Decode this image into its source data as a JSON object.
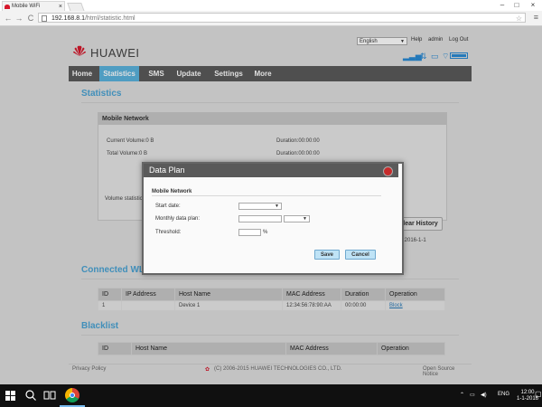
{
  "browser": {
    "tab_title": "Mobile WiFi",
    "tab_close": "×",
    "url_host": "192.168.8.1",
    "url_path": "/html/statistic.html",
    "win_min": "–",
    "win_max": "□",
    "win_close": "×",
    "back": "←",
    "forward": "→",
    "reload": "C",
    "star": "☆",
    "menu": "≡"
  },
  "header": {
    "brand": "HUAWEI",
    "language": "English",
    "links": [
      "Help",
      "admin",
      "Log Out"
    ]
  },
  "nav": {
    "items": [
      "Home",
      "Statistics",
      "SMS",
      "Update",
      "Settings",
      "More"
    ],
    "active": "Statistics"
  },
  "statistics": {
    "title": "Statistics",
    "panel_title": "Mobile Network",
    "current_volume": "Current Volume:0 B",
    "current_duration": "Duration:00:00:00",
    "total_volume": "Total Volume:0 B",
    "total_duration": "Duration:00:00:00",
    "volume_stats": "Volume statistics",
    "clear_history": "Clear History",
    "cleared_on": "ared:2016-1-1"
  },
  "connected": {
    "title": "Connected WLAN Clients",
    "columns": [
      "ID",
      "IP Address",
      "Host Name",
      "MAC Address",
      "Duration",
      "Operation"
    ],
    "rows": [
      {
        "id": "1",
        "ip": "",
        "host": "Device 1",
        "mac": "12:34:56:78:90:AA",
        "duration": "00:00:00",
        "operation": "Block"
      }
    ]
  },
  "blacklist": {
    "title": "Blacklist",
    "columns": [
      "ID",
      "Host Name",
      "MAC Address",
      "Operation"
    ]
  },
  "footer": {
    "privacy": "Privacy Policy",
    "copyright": "(C) 2006-2015 HUAWEI TECHNOLOGIES CO., LTD.",
    "open_source": "Open Source Notice"
  },
  "dialog": {
    "title": "Data Plan",
    "section": "Mobile Network",
    "start_date_label": "Start date:",
    "monthly_plan_label": "Monthly data plan:",
    "threshold_label": "Threshold:",
    "percent": "%",
    "dropdown_caret": "▼",
    "save": "Save",
    "cancel": "Cancel"
  },
  "taskbar": {
    "language": "ENG",
    "time": "12:00",
    "date": "1-1-2016"
  },
  "colors": {
    "accent": "#4aa3d4",
    "nav_active": "#5bb3dd",
    "nav_bg": "#5b5b5b",
    "close_red": "#c62b2b"
  }
}
